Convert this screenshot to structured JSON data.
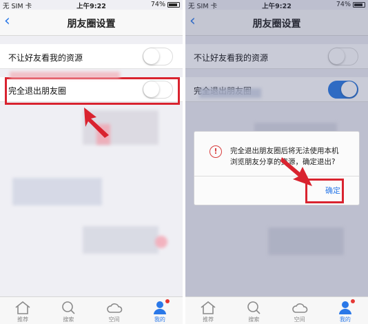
{
  "status_bar": {
    "carrier": "无 SIM 卡",
    "time": "上午9:22",
    "battery": "74%",
    "battery_level": 0.74
  },
  "nav": {
    "back_glyph": "‹",
    "title": "朋友圈设置"
  },
  "settings": {
    "hide_resources_label": "不让好友看我的资源",
    "exit_moments_label": "完全退出朋友圈"
  },
  "left_state": {
    "hide_resources_on": false,
    "exit_moments_on": false
  },
  "right_state": {
    "hide_resources_on": false,
    "exit_moments_on": true
  },
  "dialog": {
    "alert_glyph": "!",
    "message_line1": "完全退出朋友圈后将无法使用本机",
    "message_line2": "浏览朋友分享的资源，确定退出?",
    "confirm_label": "确定"
  },
  "tabs": [
    {
      "label": "推荐",
      "icon": "home-icon"
    },
    {
      "label": "搜索",
      "icon": "search-icon"
    },
    {
      "label": "空间",
      "icon": "cloud-icon"
    },
    {
      "label": "我的",
      "icon": "user-icon"
    }
  ],
  "colors": {
    "accent": "#2a78e8",
    "highlight_red": "#d9232f",
    "badge_red": "#e53935"
  }
}
